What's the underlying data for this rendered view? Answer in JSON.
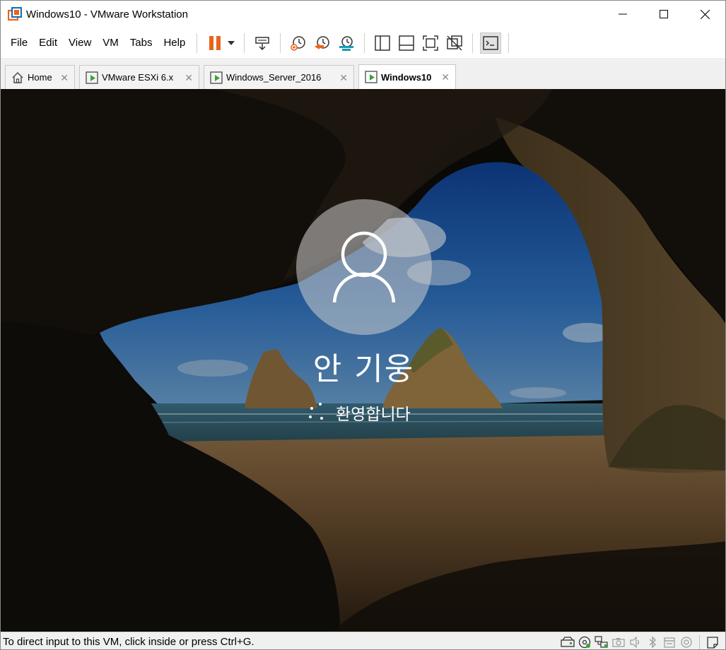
{
  "window": {
    "title": "Windows10 - VMware Workstation"
  },
  "menu": [
    "File",
    "Edit",
    "View",
    "VM",
    "Tabs",
    "Help"
  ],
  "toolbar_icons": [
    "pause-icon",
    "dropdown-arrow-icon",
    "send-ctrl-alt-del-icon",
    "snapshot-icon",
    "revert-snapshot-icon",
    "snapshot-manager-icon",
    "library-view-icon",
    "thumbnail-bar-icon",
    "full-screen-icon",
    "unity-icon",
    "console-view-icon"
  ],
  "tabs": [
    {
      "label": "Home",
      "close": "✕",
      "icon": "home-icon"
    },
    {
      "label": "VMware ESXi 6.x",
      "close": "✕",
      "icon": "vm-running-icon"
    },
    {
      "label": "Windows_Server_2016",
      "close": "✕",
      "icon": "vm-running-icon"
    },
    {
      "label": "Windows10",
      "close": "✕",
      "icon": "vm-running-icon",
      "active": true
    }
  ],
  "vm": {
    "user_name": "안 기웅",
    "welcome": "환영합니다"
  },
  "status": {
    "text": "To direct input to this VM, click inside or press Ctrl+G.",
    "icons": [
      "hard-disk-icon",
      "cd-dvd-icon",
      "network-adapter-icon",
      "camera-icon",
      "sound-card-icon",
      "bluetooth-icon",
      "printer-icon",
      "display-icon",
      "message-log-icon"
    ]
  },
  "colors": {
    "pause_orange": "#e8641e",
    "snapshot_orange": "#e8641e",
    "snapshot_teal": "#1a9ab6",
    "vm_green": "#3aa335"
  }
}
